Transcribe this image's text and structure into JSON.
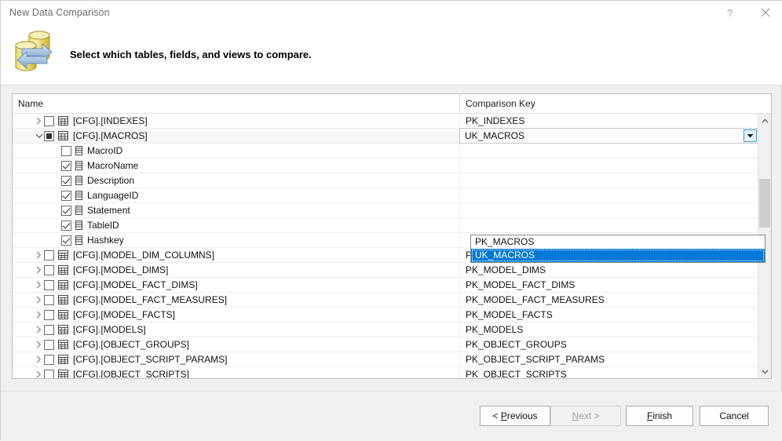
{
  "window": {
    "title": "New Data Comparison",
    "help_label": "?",
    "close_label": "close-icon"
  },
  "banner": {
    "heading": "Select which tables, fields, and views to compare.",
    "icon": "database-compare-icon"
  },
  "grid": {
    "columns": [
      "Name",
      "Comparison Key"
    ],
    "rows": [
      {
        "kind": "table",
        "label": "[CFG].[INDEXES]",
        "check": "unchecked",
        "expanded": false,
        "key": "PK_INDEXES"
      },
      {
        "kind": "table",
        "label": "[CFG].[MACROS]",
        "check": "indeterminate",
        "expanded": true,
        "key": "UK_MACROS",
        "active": true
      },
      {
        "kind": "field",
        "label": "MacroID",
        "check": "unchecked",
        "key": ""
      },
      {
        "kind": "field",
        "label": "MacroName",
        "check": "checked",
        "key": ""
      },
      {
        "kind": "field",
        "label": "Description",
        "check": "checked",
        "key": ""
      },
      {
        "kind": "field",
        "label": "LanguageID",
        "check": "checked",
        "key": ""
      },
      {
        "kind": "field",
        "label": "Statement",
        "check": "checked",
        "key": ""
      },
      {
        "kind": "field",
        "label": "TableID",
        "check": "checked",
        "key": ""
      },
      {
        "kind": "field",
        "label": "Hashkey",
        "check": "checked",
        "key": ""
      },
      {
        "kind": "table",
        "label": "[CFG].[MODEL_DIM_COLUMNS]",
        "check": "unchecked",
        "expanded": false,
        "key": "PK_MODEL_DIM_COLUMNS"
      },
      {
        "kind": "table",
        "label": "[CFG].[MODEL_DIMS]",
        "check": "unchecked",
        "expanded": false,
        "key": "PK_MODEL_DIMS"
      },
      {
        "kind": "table",
        "label": "[CFG].[MODEL_FACT_DIMS]",
        "check": "unchecked",
        "expanded": false,
        "key": "PK_MODEL_FACT_DIMS"
      },
      {
        "kind": "table",
        "label": "[CFG].[MODEL_FACT_MEASURES]",
        "check": "unchecked",
        "expanded": false,
        "key": "PK_MODEL_FACT_MEASURES"
      },
      {
        "kind": "table",
        "label": "[CFG].[MODEL_FACTS]",
        "check": "unchecked",
        "expanded": false,
        "key": "PK_MODEL_FACTS"
      },
      {
        "kind": "table",
        "label": "[CFG].[MODELS]",
        "check": "unchecked",
        "expanded": false,
        "key": "PK_MODELS"
      },
      {
        "kind": "table",
        "label": "[CFG].[OBJECT_GROUPS]",
        "check": "unchecked",
        "expanded": false,
        "key": "PK_OBJECT_GROUPS"
      },
      {
        "kind": "table",
        "label": "[CFG].[OBJECT_SCRIPT_PARAMS]",
        "check": "unchecked",
        "expanded": false,
        "key": "PK_OBJECT_SCRIPT_PARAMS"
      },
      {
        "kind": "table",
        "label": "[CFG].[OBJECT_SCRIPTS]",
        "check": "unchecked",
        "expanded": false,
        "key": "PK_OBJECT_SCRIPTS"
      }
    ]
  },
  "dropdown": {
    "open": true,
    "selected_value": "UK_MACROS",
    "options": [
      "PK_MACROS",
      "UK_MACROS"
    ],
    "selected_index": 1,
    "highlight_color": "#0078d7"
  },
  "footer": {
    "previous": {
      "prefix": "< ",
      "accel": "P",
      "rest": "revious",
      "disabled": false
    },
    "next": {
      "prefix": "",
      "accel": "N",
      "rest": "ext >",
      "disabled": true
    },
    "finish": {
      "prefix": "",
      "accel": "F",
      "rest": "inish",
      "disabled": false
    },
    "cancel": {
      "prefix": "",
      "accel": "",
      "rest": "Cancel",
      "disabled": false
    }
  }
}
